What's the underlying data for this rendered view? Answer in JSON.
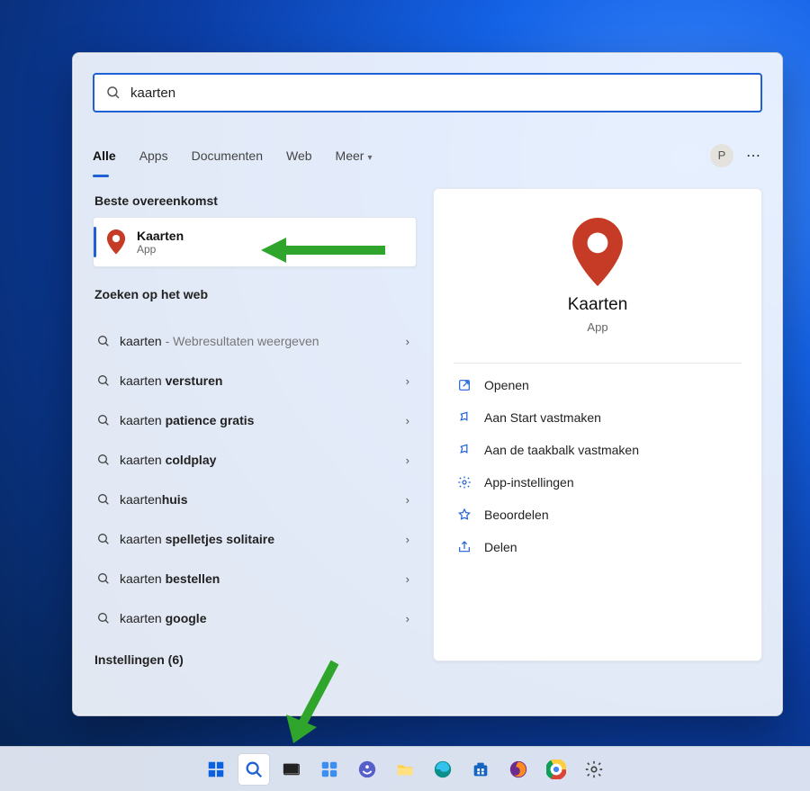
{
  "search": {
    "value": "kaarten",
    "placeholder": ""
  },
  "tabs": {
    "items": [
      "Alle",
      "Apps",
      "Documenten",
      "Web",
      "Meer"
    ],
    "active_index": 0,
    "avatar_initial": "P"
  },
  "left": {
    "best_match_heading": "Beste overeenkomst",
    "best_match": {
      "title": "Kaarten",
      "subtitle": "App"
    },
    "web_heading": "Zoeken op het web",
    "web_items": [
      {
        "prefix": "kaarten",
        "bold": "",
        "hint": " - Webresultaten weergeven"
      },
      {
        "prefix": "kaarten ",
        "bold": "versturen",
        "hint": ""
      },
      {
        "prefix": "kaarten ",
        "bold": "patience gratis",
        "hint": ""
      },
      {
        "prefix": "kaarten ",
        "bold": "coldplay",
        "hint": ""
      },
      {
        "prefix": "kaarten",
        "bold": "huis",
        "hint": ""
      },
      {
        "prefix": "kaarten ",
        "bold": "spelletjes solitaire",
        "hint": ""
      },
      {
        "prefix": "kaarten ",
        "bold": "bestellen",
        "hint": ""
      },
      {
        "prefix": "kaarten ",
        "bold": "google",
        "hint": ""
      }
    ],
    "settings_heading": "Instellingen (6)"
  },
  "right": {
    "app_name": "Kaarten",
    "app_type": "App",
    "actions": [
      {
        "icon": "open",
        "label": "Openen"
      },
      {
        "icon": "pin-start",
        "label": "Aan Start vastmaken"
      },
      {
        "icon": "pin-taskbar",
        "label": "Aan de taakbalk vastmaken"
      },
      {
        "icon": "settings",
        "label": "App-instellingen"
      },
      {
        "icon": "star",
        "label": "Beoordelen"
      },
      {
        "icon": "share",
        "label": "Delen"
      }
    ]
  },
  "taskbar": {
    "items": [
      {
        "name": "start",
        "active": false
      },
      {
        "name": "search",
        "active": true
      },
      {
        "name": "taskview",
        "active": false
      },
      {
        "name": "widgets",
        "active": false
      },
      {
        "name": "chat",
        "active": false
      },
      {
        "name": "explorer",
        "active": false
      },
      {
        "name": "edge",
        "active": false
      },
      {
        "name": "store",
        "active": false
      },
      {
        "name": "firefox",
        "active": false
      },
      {
        "name": "chrome",
        "active": false
      },
      {
        "name": "settings",
        "active": false
      }
    ]
  },
  "colors": {
    "accent": "#1f61d4",
    "arrow": "#2fa52c",
    "pin": "#c63b25"
  }
}
